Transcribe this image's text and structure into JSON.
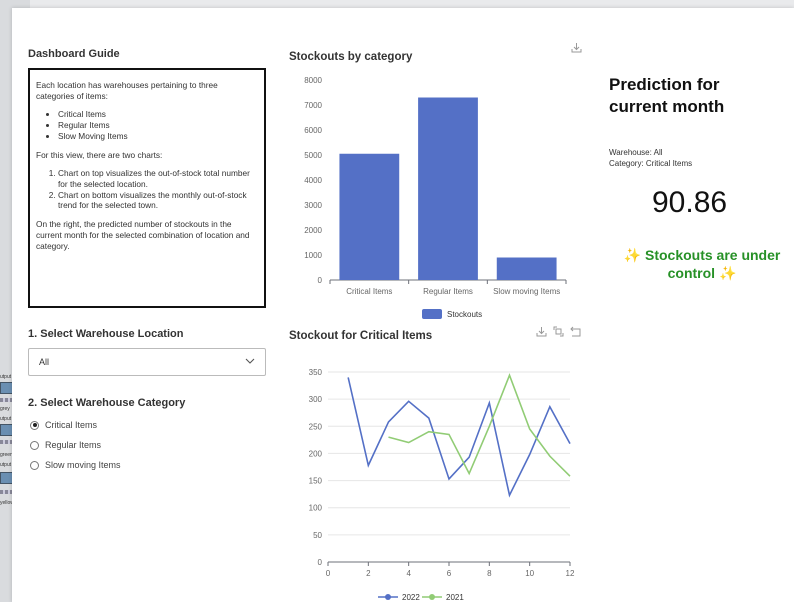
{
  "guide": {
    "title": "Dashboard Guide",
    "intro": "Each location has warehouses pertaining to three categories of items:",
    "categories": [
      "Critical Items",
      "Regular Items",
      "Slow Moving Items"
    ],
    "charts_intro": "For this view, there are two charts:",
    "charts": [
      "Chart on top visualizes the out-of-stock total number for the selected location.",
      "Chart on bottom visualizes the monthly out-of-stock trend for the selected town."
    ],
    "right_note": "On the right, the predicted number of stockouts in the current month for the selected combination of location and category."
  },
  "location": {
    "title": "1. Select Warehouse Location",
    "selected": "All"
  },
  "category": {
    "title": "2. Select Warehouse Category",
    "options": [
      "Critical Items",
      "Regular Items",
      "Slow moving Items"
    ],
    "selected_index": 0
  },
  "prediction": {
    "title": "Prediction for current month",
    "warehouse": "Warehouse: All",
    "category": "Category: Critical Items",
    "value": "90.86",
    "status": "✨ Stockouts are under control ✨"
  },
  "background_window": {
    "labels": [
      "utput V",
      "grey",
      "utput V",
      "green",
      "utput V",
      "yellow"
    ]
  },
  "colors": {
    "series_2022": "#5470c6",
    "series_2021": "#91cc75",
    "status": "#279127"
  },
  "chart_data": [
    {
      "type": "bar",
      "title": "Stockouts by category",
      "categories": [
        "Critical Items",
        "Regular Items",
        "Slow moving Items"
      ],
      "series": [
        {
          "name": "Stockouts",
          "values": [
            5050,
            7300,
            900
          ]
        }
      ],
      "ylim": [
        0,
        8000
      ],
      "yticks": [
        0,
        1000,
        2000,
        3000,
        4000,
        5000,
        6000,
        7000,
        8000
      ],
      "legend": "bottom",
      "grid": false
    },
    {
      "type": "line",
      "title": "Stockout for Critical Items",
      "x": [
        1,
        2,
        3,
        4,
        5,
        6,
        7,
        8,
        9,
        10,
        11,
        12
      ],
      "series": [
        {
          "name": "2022",
          "values": [
            340,
            178,
            258,
            296,
            265,
            153,
            193,
            293,
            123,
            198,
            286,
            218
          ]
        },
        {
          "name": "2021",
          "values": [
            null,
            null,
            230,
            220,
            240,
            235,
            163,
            250,
            344,
            245,
            195,
            158
          ]
        }
      ],
      "xlim": [
        0,
        12
      ],
      "xticks": [
        0,
        2,
        4,
        6,
        8,
        10,
        12
      ],
      "ylim": [
        0,
        350
      ],
      "yticks": [
        0,
        50,
        100,
        150,
        200,
        250,
        300,
        350
      ],
      "legend": "bottom",
      "grid": true
    }
  ]
}
